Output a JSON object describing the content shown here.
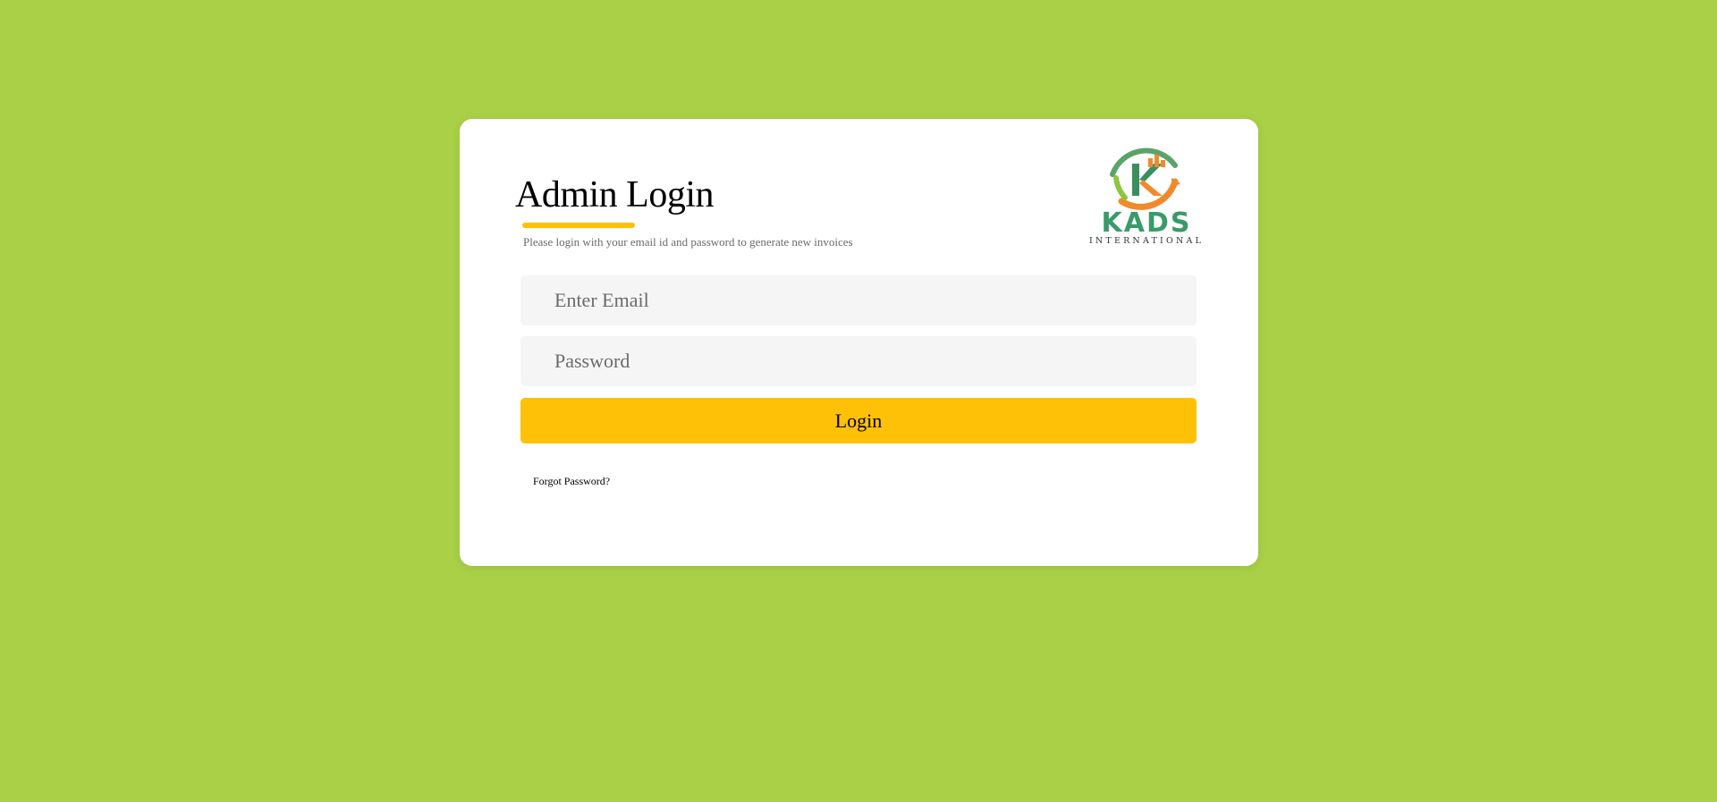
{
  "page": {
    "background_color": "#a9d046",
    "accent_color": "#ffc107"
  },
  "login": {
    "title": "Admin Login",
    "subtitle": "Please login with your email id and password to generate new invoices",
    "email_placeholder": "Enter Email",
    "email_value": "",
    "password_placeholder": "Password",
    "password_value": "",
    "login_label": "Login",
    "forgot_label": "Forgot Password?"
  },
  "logo": {
    "icon": "kads-international-logo",
    "wordmark": "KADS",
    "tagline": "INTERNATIONAL"
  }
}
